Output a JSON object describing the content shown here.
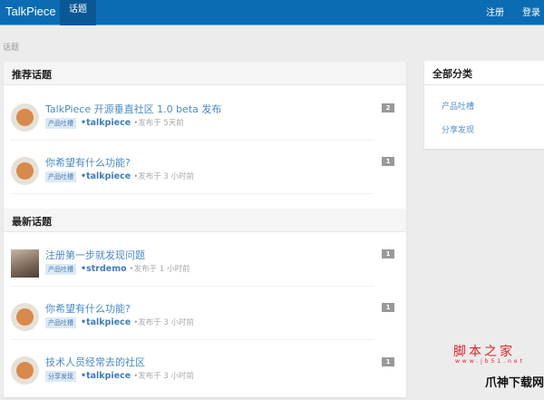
{
  "nav": {
    "brand": "TalkPiece",
    "active": "话题",
    "register": "注册",
    "login": "登录"
  },
  "breadcrumb": "话题",
  "recommended": {
    "heading": "推荐话题",
    "items": [
      {
        "title": "TalkPiece 开源垂直社区 1.0 beta 发布",
        "tag": "产品吐槽",
        "user": "•talkpiece",
        "time": "•发布于 5天前",
        "count": "2"
      },
      {
        "title": "你希望有什么功能?",
        "tag": "产品吐槽",
        "user": "•talkpiece",
        "time": "•发布于 3 小时前",
        "count": "1"
      }
    ]
  },
  "latest": {
    "heading": "最新话题",
    "items": [
      {
        "title": "注册第一步就发现问题",
        "tag": "产品吐槽",
        "user": "•strdemo",
        "time": "•发布于 1 小时前",
        "count": "1"
      },
      {
        "title": "你希望有什么功能?",
        "tag": "产品吐槽",
        "user": "•talkpiece",
        "time": "•发布于 3 小时前",
        "count": "1"
      },
      {
        "title": "技术人员经常去的社区",
        "tag": "分享发现",
        "user": "•talkpiece",
        "time": "•发布于 3 小时前",
        "count": "1"
      }
    ]
  },
  "sidebar": {
    "heading": "全部分类",
    "categories": [
      "产品吐槽",
      "分享发现"
    ]
  },
  "watermark": {
    "line1": "脚本之家",
    "line2": "www.jb51.net",
    "line3": "爪神下载网"
  }
}
